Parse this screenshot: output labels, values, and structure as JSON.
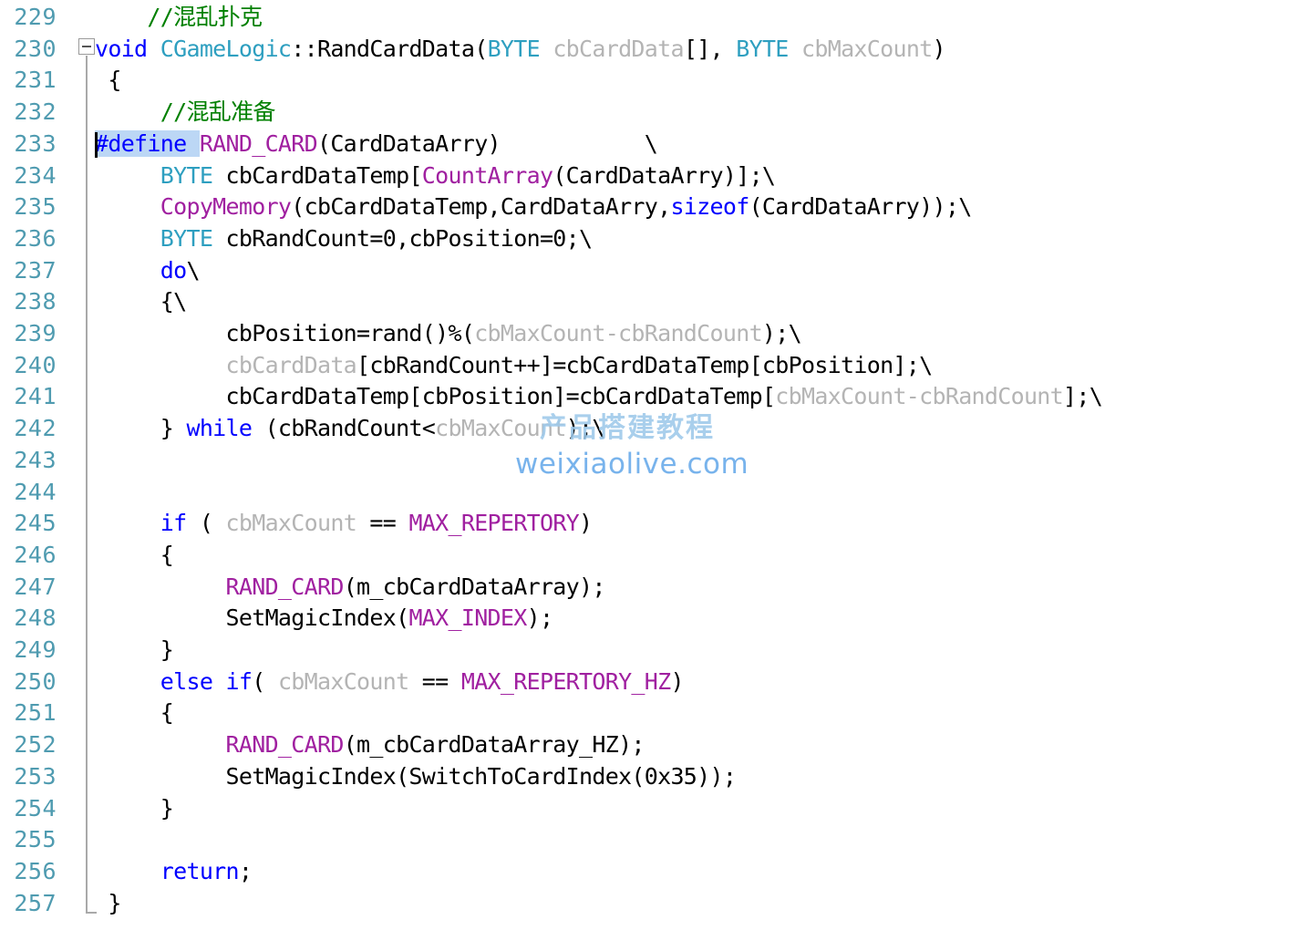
{
  "editor": {
    "language": "C++",
    "first_line_number": 229,
    "last_line_number": 257,
    "colors": {
      "background": "#ffffff",
      "line_number": "#4f9bb0",
      "keyword": "#0000ff",
      "type": "#2e9fc0",
      "macro": "#a020a0",
      "comment": "#008000",
      "inactive_identifier": "#b4b4b4",
      "selection": "#bcd7f5",
      "fold_line": "#a9a9a9"
    }
  },
  "gutter": {
    "line_numbers": [
      "229",
      "230",
      "231",
      "232",
      "233",
      "234",
      "235",
      "236",
      "237",
      "238",
      "239",
      "240",
      "241",
      "242",
      "243",
      "244",
      "245",
      "246",
      "247",
      "248",
      "249",
      "250",
      "251",
      "252",
      "253",
      "254",
      "255",
      "256",
      "257"
    ]
  },
  "outline": {
    "collapse_toggle_label": "-",
    "collapse_toggle_line": "230",
    "collapse_state": "expanded"
  },
  "selection": {
    "text": "#define ",
    "line": "233"
  },
  "lines": [
    {
      "n": "229",
      "segments": [
        {
          "t": "    ",
          "c": "plain"
        },
        {
          "t": "//混乱扑克",
          "c": "comment"
        }
      ]
    },
    {
      "n": "230",
      "segments": [
        {
          "t": "void",
          "c": "kw"
        },
        {
          "t": " ",
          "c": "plain"
        },
        {
          "t": "CGameLogic",
          "c": "type"
        },
        {
          "t": "::RandCardData(",
          "c": "plain"
        },
        {
          "t": "BYTE",
          "c": "type"
        },
        {
          "t": " ",
          "c": "plain"
        },
        {
          "t": "cbCardData",
          "c": "dim"
        },
        {
          "t": "[], ",
          "c": "plain"
        },
        {
          "t": "BYTE",
          "c": "type"
        },
        {
          "t": " ",
          "c": "plain"
        },
        {
          "t": "cbMaxCount",
          "c": "dim"
        },
        {
          "t": ")",
          "c": "plain"
        }
      ]
    },
    {
      "n": "231",
      "segments": [
        {
          "t": " {",
          "c": "plain"
        }
      ]
    },
    {
      "n": "232",
      "segments": [
        {
          "t": "     ",
          "c": "plain"
        },
        {
          "t": "//混乱准备",
          "c": "comment"
        }
      ]
    },
    {
      "n": "233",
      "segments": [
        {
          "t": "#define ",
          "c": "kw",
          "sel": true
        },
        {
          "t": "RAND_CARD",
          "c": "macro"
        },
        {
          "t": "(CardDataArry)           \\",
          "c": "plain"
        }
      ]
    },
    {
      "n": "234",
      "segments": [
        {
          "t": "     ",
          "c": "plain"
        },
        {
          "t": "BYTE",
          "c": "type"
        },
        {
          "t": " cbCardDataTemp[",
          "c": "plain"
        },
        {
          "t": "CountArray",
          "c": "macro"
        },
        {
          "t": "(CardDataArry)];\\",
          "c": "plain"
        }
      ]
    },
    {
      "n": "235",
      "segments": [
        {
          "t": "     ",
          "c": "plain"
        },
        {
          "t": "CopyMemory",
          "c": "macro"
        },
        {
          "t": "(cbCardDataTemp,CardDataArry,",
          "c": "plain"
        },
        {
          "t": "sizeof",
          "c": "kw"
        },
        {
          "t": "(CardDataArry));\\",
          "c": "plain"
        }
      ]
    },
    {
      "n": "236",
      "segments": [
        {
          "t": "     ",
          "c": "plain"
        },
        {
          "t": "BYTE",
          "c": "type"
        },
        {
          "t": " cbRandCount=0,cbPosition=0;\\",
          "c": "plain"
        }
      ]
    },
    {
      "n": "237",
      "segments": [
        {
          "t": "     ",
          "c": "plain"
        },
        {
          "t": "do",
          "c": "kw"
        },
        {
          "t": "\\",
          "c": "plain"
        }
      ]
    },
    {
      "n": "238",
      "segments": [
        {
          "t": "     {\\",
          "c": "plain"
        }
      ]
    },
    {
      "n": "239",
      "segments": [
        {
          "t": "          cbPosition=rand()%(",
          "c": "plain"
        },
        {
          "t": "cbMaxCount-cbRandCount",
          "c": "dim"
        },
        {
          "t": ");\\",
          "c": "plain"
        }
      ]
    },
    {
      "n": "240",
      "segments": [
        {
          "t": "          ",
          "c": "plain"
        },
        {
          "t": "cbCardData",
          "c": "dim"
        },
        {
          "t": "[cbRandCount++]=cbCardDataTemp[cbPosition];\\",
          "c": "plain"
        }
      ]
    },
    {
      "n": "241",
      "segments": [
        {
          "t": "          cbCardDataTemp[cbPosition]=cbCardDataTemp[",
          "c": "plain"
        },
        {
          "t": "cbMaxCount-cbRandCount",
          "c": "dim"
        },
        {
          "t": "];\\",
          "c": "plain"
        }
      ]
    },
    {
      "n": "242",
      "segments": [
        {
          "t": "     } ",
          "c": "plain"
        },
        {
          "t": "while",
          "c": "kw"
        },
        {
          "t": " (cbRandCount<",
          "c": "plain"
        },
        {
          "t": "cbMaxCount",
          "c": "dim"
        },
        {
          "t": ");\\",
          "c": "plain"
        }
      ]
    },
    {
      "n": "243",
      "segments": []
    },
    {
      "n": "244",
      "segments": []
    },
    {
      "n": "245",
      "segments": [
        {
          "t": "     ",
          "c": "plain"
        },
        {
          "t": "if",
          "c": "kw"
        },
        {
          "t": " ( ",
          "c": "plain"
        },
        {
          "t": "cbMaxCount",
          "c": "dim"
        },
        {
          "t": " == ",
          "c": "plain"
        },
        {
          "t": "MAX_REPERTORY",
          "c": "macro"
        },
        {
          "t": ")",
          "c": "plain"
        }
      ]
    },
    {
      "n": "246",
      "segments": [
        {
          "t": "     {",
          "c": "plain"
        }
      ]
    },
    {
      "n": "247",
      "segments": [
        {
          "t": "          ",
          "c": "plain"
        },
        {
          "t": "RAND_CARD",
          "c": "macro"
        },
        {
          "t": "(m_cbCardDataArray);",
          "c": "plain"
        }
      ]
    },
    {
      "n": "248",
      "segments": [
        {
          "t": "          SetMagicIndex(",
          "c": "plain"
        },
        {
          "t": "MAX_INDEX",
          "c": "macro"
        },
        {
          "t": ");",
          "c": "plain"
        }
      ]
    },
    {
      "n": "249",
      "segments": [
        {
          "t": "     }",
          "c": "plain"
        }
      ]
    },
    {
      "n": "250",
      "segments": [
        {
          "t": "     ",
          "c": "plain"
        },
        {
          "t": "else if",
          "c": "kw"
        },
        {
          "t": "( ",
          "c": "plain"
        },
        {
          "t": "cbMaxCount",
          "c": "dim"
        },
        {
          "t": " == ",
          "c": "plain"
        },
        {
          "t": "MAX_REPERTORY_HZ",
          "c": "macro"
        },
        {
          "t": ")",
          "c": "plain"
        }
      ]
    },
    {
      "n": "251",
      "segments": [
        {
          "t": "     {",
          "c": "plain"
        }
      ]
    },
    {
      "n": "252",
      "segments": [
        {
          "t": "          ",
          "c": "plain"
        },
        {
          "t": "RAND_CARD",
          "c": "macro"
        },
        {
          "t": "(m_cbCardDataArray_HZ);",
          "c": "plain"
        }
      ]
    },
    {
      "n": "253",
      "segments": [
        {
          "t": "          SetMagicIndex(SwitchToCardIndex(0x35));",
          "c": "plain"
        }
      ]
    },
    {
      "n": "254",
      "segments": [
        {
          "t": "     }",
          "c": "plain"
        }
      ]
    },
    {
      "n": "255",
      "segments": []
    },
    {
      "n": "256",
      "segments": [
        {
          "t": "     ",
          "c": "plain"
        },
        {
          "t": "return",
          "c": "kw"
        },
        {
          "t": ";",
          "c": "plain"
        }
      ]
    },
    {
      "n": "257",
      "segments": [
        {
          "t": " }",
          "c": "plain"
        }
      ]
    }
  ],
  "watermark": {
    "chinese": "产品搭建教程",
    "url": "weixiaolive.com"
  }
}
